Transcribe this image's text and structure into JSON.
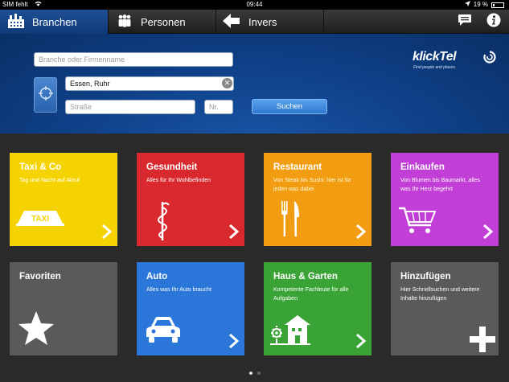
{
  "statusbar": {
    "carrier": "SIM fehlt",
    "time": "09:44",
    "battery": "19 %"
  },
  "tabs": [
    {
      "label": "Branchen",
      "icon": "buildings-icon",
      "active": true
    },
    {
      "label": "Personen",
      "icon": "people-icon",
      "active": false
    },
    {
      "label": "Invers",
      "icon": "arrow-left-icon",
      "active": false
    }
  ],
  "search": {
    "firma_placeholder": "Branche oder Firmenname",
    "ort_value": "Essen, Ruhr",
    "strasse_placeholder": "Straße",
    "nr_placeholder": "Nr.",
    "search_label": "Suchen"
  },
  "logo": {
    "name": "klickTel",
    "tagline": "Find people and places."
  },
  "tiles": [
    {
      "title": "Taxi & Co",
      "subtitle": "Tag und Nacht auf Abruf",
      "icon": "taxi-icon",
      "color": "#f4d300"
    },
    {
      "title": "Gesundheit",
      "subtitle": "Alles für Ihr Wohlbefinden",
      "icon": "caduceus-icon",
      "color": "#d9292e"
    },
    {
      "title": "Restaurant",
      "subtitle": "Von Steak bis Sushi: hier ist für jeden was dabei",
      "icon": "cutlery-icon",
      "color": "#f29d11"
    },
    {
      "title": "Einkaufen",
      "subtitle": "Von Blumen bis Baumarkt, alles was Ihr Herz begehrt",
      "icon": "shopping-cart-icon",
      "color": "#c13fd6"
    },
    {
      "title": "Favoriten",
      "subtitle": "",
      "icon": "star-icon",
      "color": "#5a5a5a"
    },
    {
      "title": "Auto",
      "subtitle": "Alles was Ihr Auto braucht",
      "icon": "car-icon",
      "color": "#2b77d9"
    },
    {
      "title": "Haus & Garten",
      "subtitle": "Kompetente Fachleute für alle Aufgaben",
      "icon": "house-garden-icon",
      "color": "#3aa335"
    },
    {
      "title": "Hinzufügen",
      "subtitle": "Hier Schnellsuchen und weitere Inhalte hinzufügen",
      "icon": "plus-icon",
      "color": "#5a5a5a"
    }
  ],
  "pagination": {
    "pages": 2,
    "current": 1
  }
}
